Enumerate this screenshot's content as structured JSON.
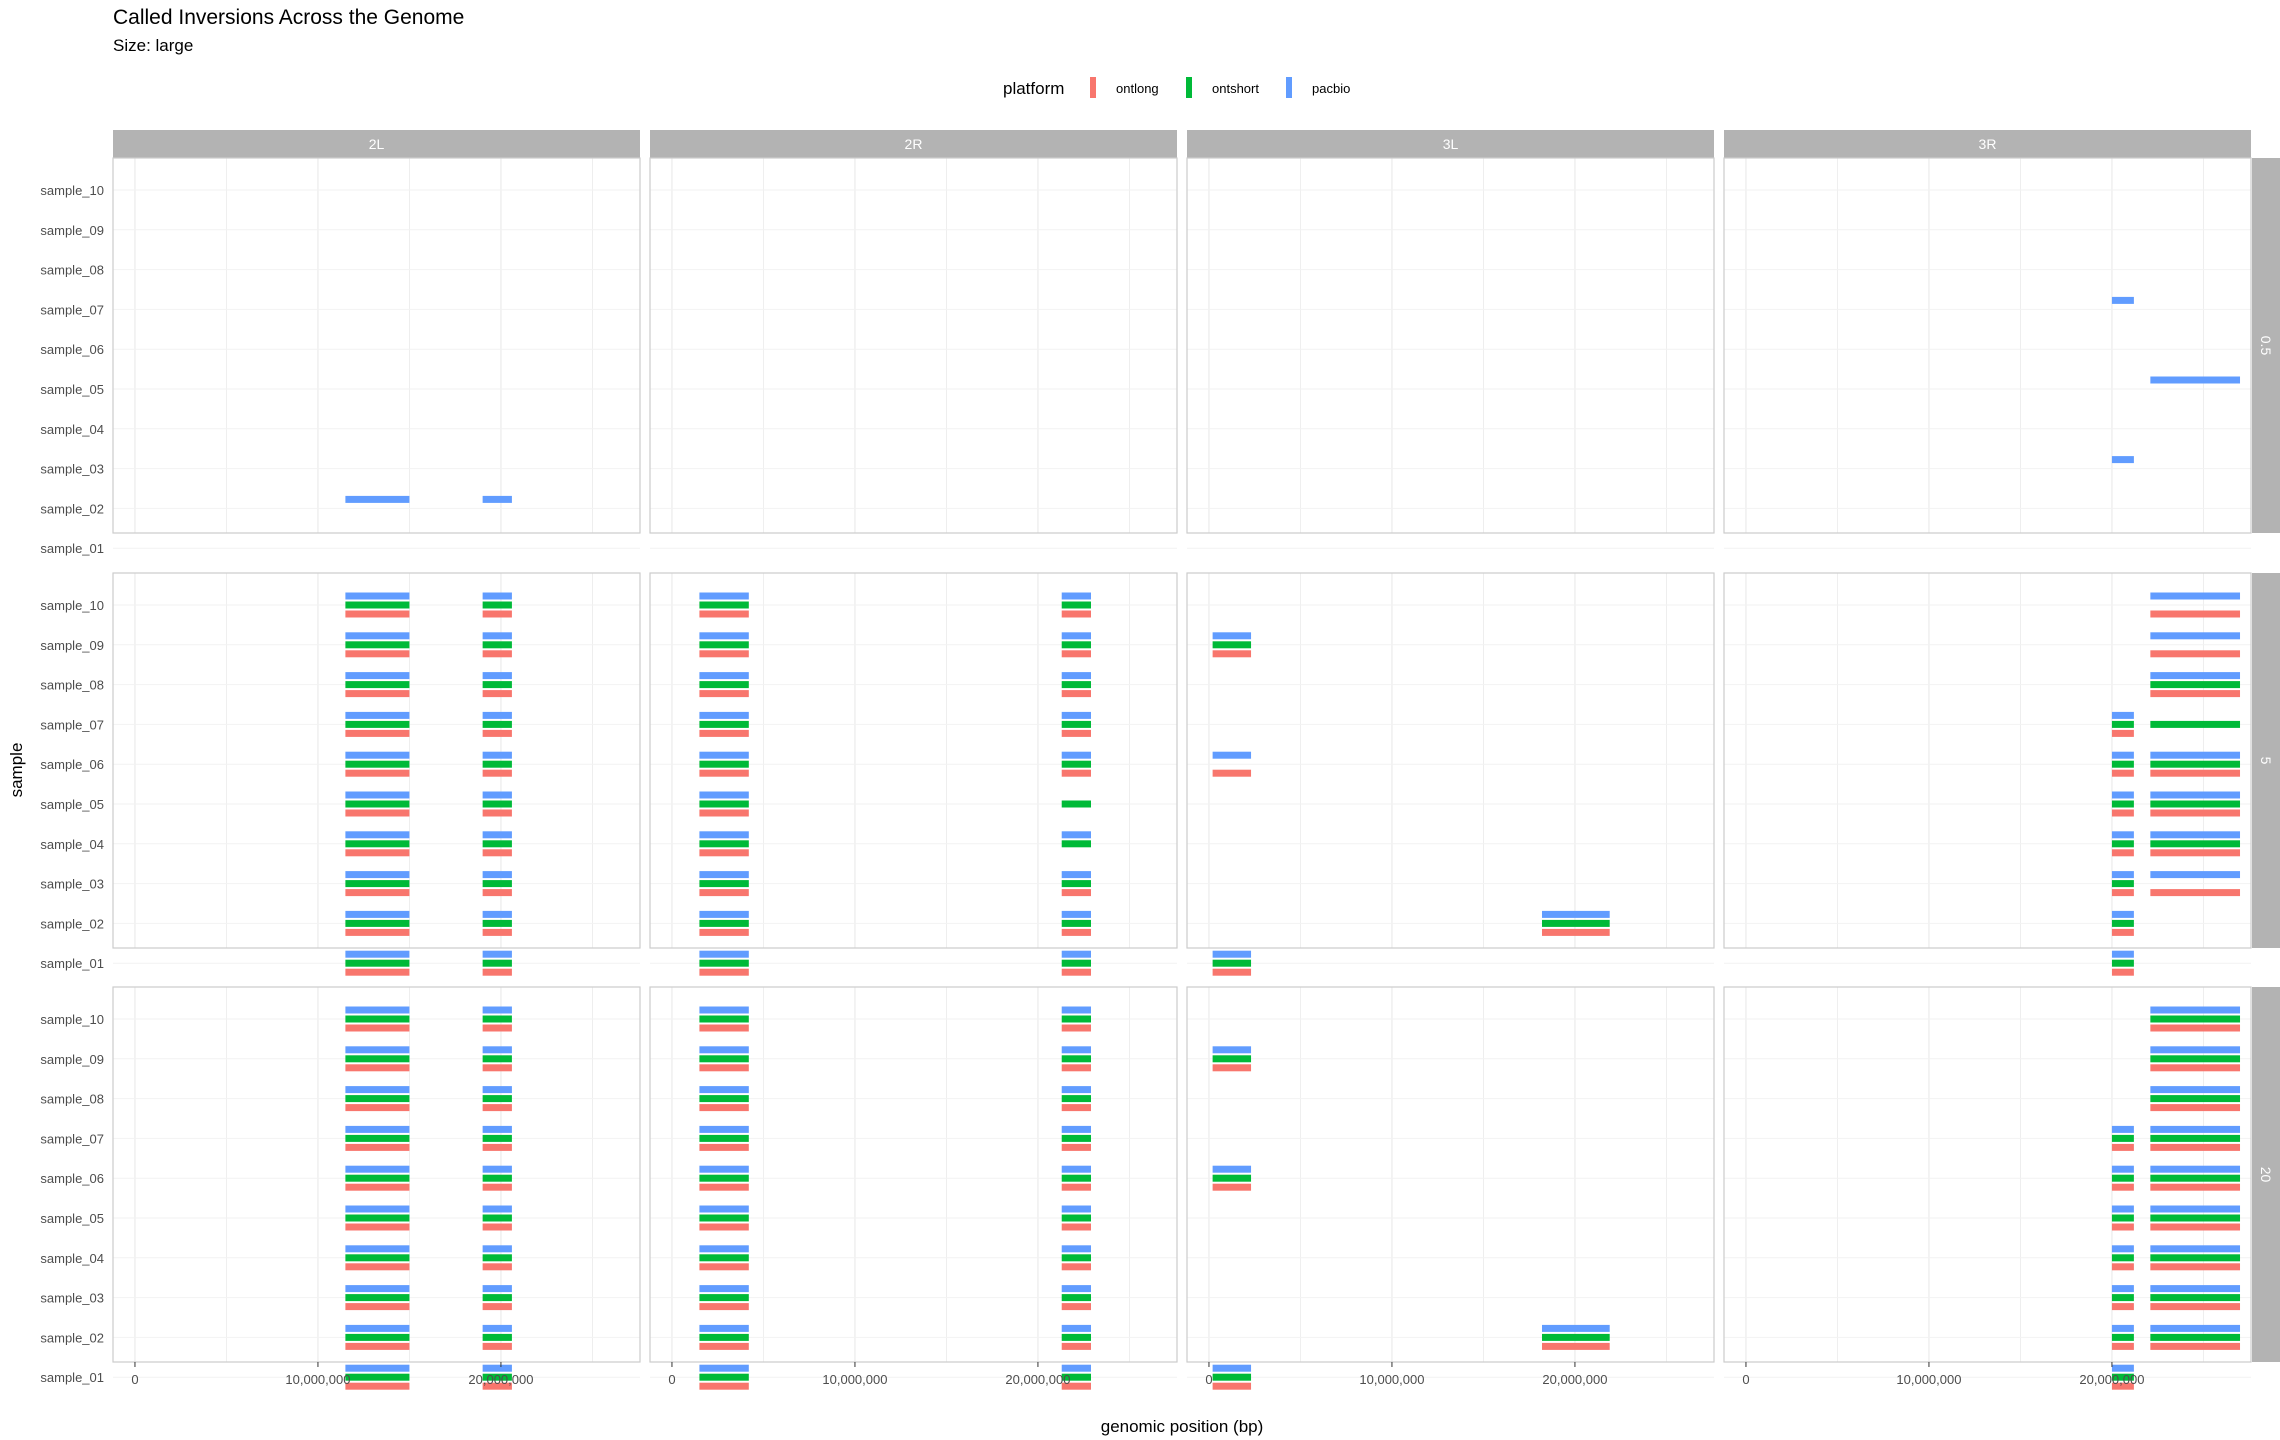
{
  "chart_data": {
    "type": "bar",
    "title": "Called Inversions Across the Genome",
    "subtitle": "Size: large",
    "xlabel": "genomic position (bp)",
    "ylabel": "sample",
    "legend": {
      "title": "platform",
      "placement": "top",
      "entries": [
        {
          "name": "ontlong",
          "color": "#F8766D"
        },
        {
          "name": "ontshort",
          "color": "#00BA38"
        },
        {
          "name": "pacbio",
          "color": "#619CFF"
        }
      ]
    },
    "columns": [
      "2L",
      "2R",
      "3L",
      "3R"
    ],
    "rows": [
      "0.5",
      "5",
      "20"
    ],
    "samples": [
      "sample_01",
      "sample_02",
      "sample_03",
      "sample_04",
      "sample_05",
      "sample_06",
      "sample_07",
      "sample_08",
      "sample_09",
      "sample_10"
    ],
    "xlim": [
      -1200000,
      27600000
    ],
    "x_ticks": [
      0,
      10000000,
      20000000
    ],
    "x_tick_labels": [
      "0",
      "10,000,000",
      "20,000,000"
    ],
    "grid": true,
    "segments": {
      "0.5": {
        "2L": [
          {
            "sample": "sample_02",
            "platform": "pacbio",
            "start": 11500000,
            "end": 15000000
          },
          {
            "sample": "sample_02",
            "platform": "pacbio",
            "start": 19000000,
            "end": 20600000
          }
        ],
        "2R": [],
        "3L": [],
        "3R": [
          {
            "sample": "sample_07",
            "platform": "pacbio",
            "start": 20000000,
            "end": 21200000
          },
          {
            "sample": "sample_05",
            "platform": "pacbio",
            "start": 22100000,
            "end": 27000000
          },
          {
            "sample": "sample_03",
            "platform": "pacbio",
            "start": 20000000,
            "end": 21200000
          }
        ]
      },
      "5": {
        "2L": [
          {
            "samples": "all",
            "platforms": [
              "pacbio",
              "ontshort",
              "ontlong"
            ],
            "start": 11500000,
            "end": 15000000
          },
          {
            "samples": "all",
            "platforms": [
              "pacbio",
              "ontshort",
              "ontlong"
            ],
            "start": 19000000,
            "end": 20600000
          }
        ],
        "2R": [
          {
            "samples": "all",
            "platforms": [
              "pacbio",
              "ontshort",
              "ontlong"
            ],
            "start": 1500000,
            "end": 4200000
          },
          {
            "samples": [
              "sample_01",
              "sample_02",
              "sample_03",
              "sample_06",
              "sample_07",
              "sample_08",
              "sample_09",
              "sample_10"
            ],
            "platforms": [
              "pacbio",
              "ontshort",
              "ontlong"
            ],
            "start": 21300000,
            "end": 22900000
          },
          {
            "samples": [
              "sample_04"
            ],
            "platforms": [
              "pacbio",
              "ontshort"
            ],
            "start": 21300000,
            "end": 22900000
          },
          {
            "samples": [
              "sample_05"
            ],
            "platforms": [
              "ontshort"
            ],
            "start": 21300000,
            "end": 22900000
          }
        ],
        "3L": [
          {
            "samples": [
              "sample_09",
              "sample_01"
            ],
            "platforms": [
              "pacbio",
              "ontshort",
              "ontlong"
            ],
            "start": 200000,
            "end": 2300000
          },
          {
            "samples": [
              "sample_06"
            ],
            "platforms": [
              "pacbio",
              "ontlong"
            ],
            "start": 200000,
            "end": 2300000
          },
          {
            "samples": [
              "sample_02"
            ],
            "platforms": [
              "pacbio",
              "ontshort",
              "ontlong"
            ],
            "start": 18200000,
            "end": 21900000
          }
        ],
        "3R": [
          {
            "samples": [
              "sample_10",
              "sample_09"
            ],
            "platforms": [
              "pacbio",
              "ontlong"
            ],
            "start": 22100000,
            "end": 27000000
          },
          {
            "samples": [
              "sample_08",
              "sample_06",
              "sample_05",
              "sample_04"
            ],
            "platforms": [
              "pacbio",
              "ontshort",
              "ontlong"
            ],
            "start": 22100000,
            "end": 27000000
          },
          {
            "samples": [
              "sample_07"
            ],
            "platforms": [
              "ontshort"
            ],
            "start": 22100000,
            "end": 27000000
          },
          {
            "samples": [
              "sample_03"
            ],
            "platforms": [
              "pacbio",
              "ontlong"
            ],
            "start": 22100000,
            "end": 27000000
          },
          {
            "samples": [
              "sample_07",
              "sample_06",
              "sample_05",
              "sample_04",
              "sample_03",
              "sample_02",
              "sample_01"
            ],
            "platforms": [
              "pacbio",
              "ontshort",
              "ontlong"
            ],
            "start": 20000000,
            "end": 21200000
          }
        ]
      },
      "20": {
        "2L": [
          {
            "samples": "all",
            "platforms": [
              "pacbio",
              "ontshort",
              "ontlong"
            ],
            "start": 11500000,
            "end": 15000000
          },
          {
            "samples": "all",
            "platforms": [
              "pacbio",
              "ontshort",
              "ontlong"
            ],
            "start": 19000000,
            "end": 20600000
          }
        ],
        "2R": [
          {
            "samples": "all",
            "platforms": [
              "pacbio",
              "ontshort",
              "ontlong"
            ],
            "start": 1500000,
            "end": 4200000
          },
          {
            "samples": "all",
            "platforms": [
              "pacbio",
              "ontshort",
              "ontlong"
            ],
            "start": 21300000,
            "end": 22900000
          }
        ],
        "3L": [
          {
            "samples": [
              "sample_09",
              "sample_06",
              "sample_01"
            ],
            "platforms": [
              "pacbio",
              "ontshort",
              "ontlong"
            ],
            "start": 200000,
            "end": 2300000
          },
          {
            "samples": [
              "sample_02"
            ],
            "platforms": [
              "pacbio",
              "ontshort",
              "ontlong"
            ],
            "start": 18200000,
            "end": 21900000
          }
        ],
        "3R": [
          {
            "samples": [
              "sample_10",
              "sample_09",
              "sample_08",
              "sample_07",
              "sample_06",
              "sample_05",
              "sample_04",
              "sample_03",
              "sample_02"
            ],
            "platforms": [
              "pacbio",
              "ontshort",
              "ontlong"
            ],
            "start": 22100000,
            "end": 27000000
          },
          {
            "samples": [
              "sample_07",
              "sample_06",
              "sample_05",
              "sample_04",
              "sample_03",
              "sample_02",
              "sample_01"
            ],
            "platforms": [
              "pacbio",
              "ontshort",
              "ontlong"
            ],
            "start": 20000000,
            "end": 21200000
          }
        ]
      }
    }
  }
}
